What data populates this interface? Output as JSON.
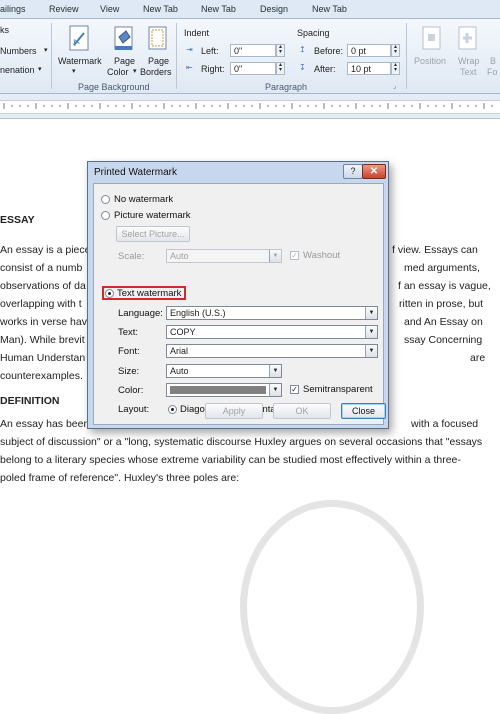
{
  "ribbon": {
    "tabs": [
      "ailings",
      "Review",
      "View",
      "New Tab",
      "New Tab",
      "Design",
      "New Tab"
    ],
    "left_items": [
      "ks",
      "Numbers",
      "nenation"
    ],
    "page_background": {
      "label": "Page Background",
      "watermark": "Watermark",
      "page_color_1": "Page",
      "page_color_2": "Color",
      "page_borders_1": "Page",
      "page_borders_2": "Borders"
    },
    "paragraph": {
      "label": "Paragraph",
      "indent_title": "Indent",
      "left_label": "Left:",
      "left_value": "0\"",
      "right_label": "Right:",
      "right_value": "0\"",
      "spacing_title": "Spacing",
      "before_label": "Before:",
      "before_value": "0 pt",
      "after_label": "After:",
      "after_value": "10 pt"
    },
    "arrange": {
      "position": "Position",
      "wrap_1": "Wrap",
      "wrap_2": "Text",
      "bring": "B",
      "bring_2": "Fo"
    }
  },
  "document": {
    "lines": [
      {
        "text": "ESSAY",
        "bold": true
      },
      {
        "text": "An essay is a piece",
        "right": "f view. Essays can"
      },
      {
        "text": "consist of a numb",
        "right": "med arguments,"
      },
      {
        "text": "observations of da",
        "right": "f an essay is vague,"
      },
      {
        "text": "overlapping with t",
        "right": "ritten in prose, but"
      },
      {
        "text": "works in verse hav",
        "right": "and An Essay on"
      },
      {
        "text": "Man). While brevit",
        "right": "ssay Concerning"
      },
      {
        "text": "Human Understan",
        "right": "are"
      },
      {
        "text": "counterexamples.",
        "right": ""
      },
      {
        "text": "DEFINITION",
        "bold": true
      },
      {
        "text": "An essay has been",
        "right": "with a focused"
      },
      {
        "text": "subject of discussion\" or a \"long, systematic discourse Huxley argues on several occasions that \"essays",
        "right": ""
      },
      {
        "text": "belong to a literary species whose extreme variability can be studied most effectively within a three-",
        "right": ""
      },
      {
        "text": "poled frame of reference\". Huxley's three poles are:",
        "right": ""
      }
    ]
  },
  "dialog": {
    "title": "Printed Watermark",
    "help": "?",
    "close": "✕",
    "no_watermark": "No watermark",
    "picture_watermark": "Picture watermark",
    "select_picture": "Select Picture...",
    "scale_label": "Scale:",
    "scale_value": "Auto",
    "washout": "Washout",
    "text_watermark": "Text watermark",
    "language_label": "Language:",
    "language_value": "English (U.S.)",
    "text_label": "Text:",
    "text_value": "COPY",
    "font_label": "Font:",
    "font_value": "Arial",
    "size_label": "Size:",
    "size_value": "Auto",
    "color_label": "Color:",
    "color_value": "#808080",
    "semitransparent": "Semitransparent",
    "layout_label": "Layout:",
    "diagonal": "Diagonal",
    "horizontal": "Horizontal",
    "apply": "Apply",
    "ok": "OK",
    "cancel": "Close",
    "selected_option": "Text watermark"
  },
  "colors": {
    "highlight": "#d12a2a",
    "ribbon": "#dfe8f3",
    "dialog_frame": "#c7d8ee"
  }
}
